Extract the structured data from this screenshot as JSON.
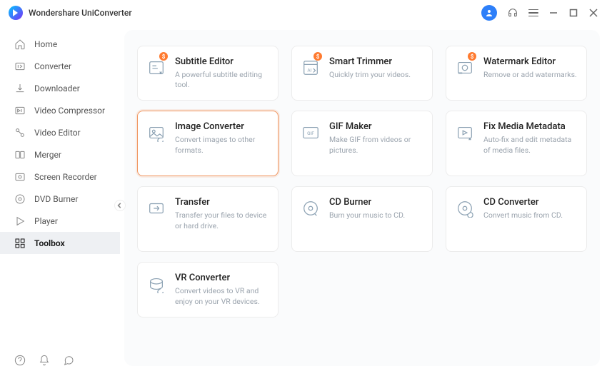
{
  "app": {
    "title": "Wondershare UniConverter"
  },
  "sidebar": {
    "items": [
      {
        "label": "Home"
      },
      {
        "label": "Converter"
      },
      {
        "label": "Downloader"
      },
      {
        "label": "Video Compressor"
      },
      {
        "label": "Video Editor"
      },
      {
        "label": "Merger"
      },
      {
        "label": "Screen Recorder"
      },
      {
        "label": "DVD Burner"
      },
      {
        "label": "Player"
      },
      {
        "label": "Toolbox"
      }
    ]
  },
  "badge_glyph": "$",
  "tools": [
    {
      "title": "Subtitle Editor",
      "desc": "A powerful subtitle editing tool.",
      "badge": true
    },
    {
      "title": "Smart Trimmer",
      "desc": "Quickly trim your videos.",
      "badge": true
    },
    {
      "title": "Watermark Editor",
      "desc": "Remove or add watermarks.",
      "badge": true
    },
    {
      "title": "Image Converter",
      "desc": "Convert images to other formats.",
      "badge": false,
      "selected": true
    },
    {
      "title": "GIF Maker",
      "desc": "Make GIF from videos or pictures.",
      "badge": false,
      "gif": true
    },
    {
      "title": "Fix Media Metadata",
      "desc": "Auto-fix and edit metadata of media files.",
      "badge": false
    },
    {
      "title": "Transfer",
      "desc": "Transfer your files to device or hard drive.",
      "badge": false
    },
    {
      "title": "CD Burner",
      "desc": "Burn your music to CD.",
      "badge": false
    },
    {
      "title": "CD Converter",
      "desc": "Convert music from CD.",
      "badge": false
    },
    {
      "title": "VR Converter",
      "desc": "Convert videos to VR and enjoy on your VR devices.",
      "badge": false
    }
  ]
}
